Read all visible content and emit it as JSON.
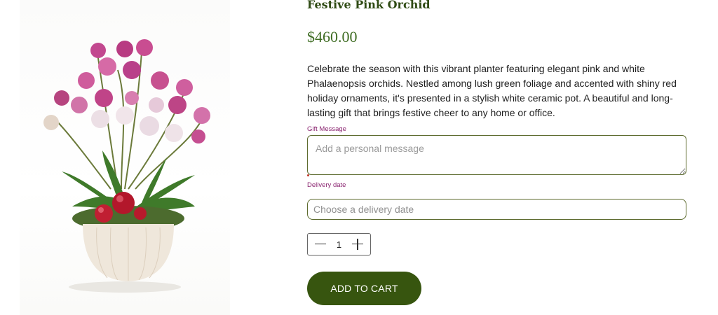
{
  "product": {
    "title": "Festive Pink Orchid",
    "price": "$460.00",
    "description": "Celebrate the season with this vibrant planter featuring elegant pink and white Phalaenopsis orchids. Nestled among lush green foliage and accented with shiny red holiday ornaments, it's presented in a stylish white ceramic pot. A beautiful and long-lasting gift that brings festive cheer to any home or office."
  },
  "form": {
    "gift_message": {
      "label": "Gift Message",
      "placeholder": "Add a personal message",
      "value": ""
    },
    "delivery_date": {
      "label": "Delivery date",
      "placeholder": "Choose a delivery date",
      "value": ""
    },
    "quantity": {
      "value": "1"
    },
    "add_to_cart_label": "ADD TO CART"
  },
  "colors": {
    "title": "#2f4b14",
    "price": "#3d6b21",
    "label": "#8a2470",
    "button": "#37550f",
    "input_border": "#5d6b2e"
  },
  "icons": {
    "decrease": "minus-icon",
    "increase": "plus-icon"
  }
}
